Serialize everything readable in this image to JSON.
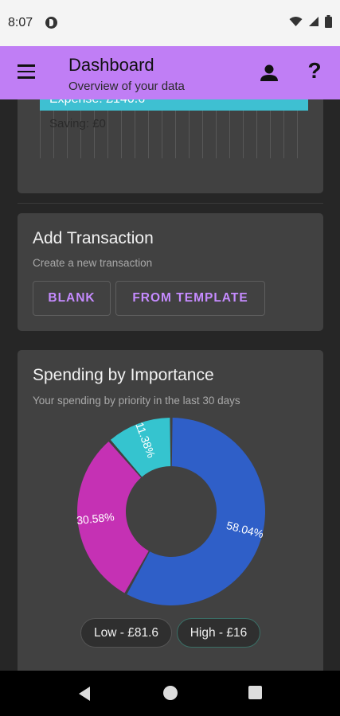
{
  "status_bar": {
    "time": "8:07",
    "icons": [
      "app-notification-icon",
      "wifi-icon",
      "signal-icon",
      "battery-icon"
    ]
  },
  "app_bar": {
    "title": "Dashboard",
    "subtitle": "Overview of your data",
    "icons": [
      "menu-icon",
      "account-icon",
      "help-icon"
    ],
    "help_glyph": "?",
    "color": "#c07ef5"
  },
  "overview_card": {
    "expense_label": "Expense: £140.6",
    "saving_label": "Saving: £0",
    "expense_color": "#3ec0d2"
  },
  "add_transaction": {
    "title": "Add Transaction",
    "subtitle": "Create a new transaction",
    "blank_label": "BLANK",
    "template_label": "FROM TEMPLATE"
  },
  "spending_importance": {
    "title": "Spending by Importance",
    "subtitle": "Your spending by priority in the last 30 days",
    "chips": {
      "low": "Low - £81.6",
      "high": "High - £16"
    }
  },
  "chart_data": {
    "type": "pie",
    "donut": true,
    "slices": [
      {
        "label": "58.04%",
        "value": 58.04,
        "color": "#2f5fc8"
      },
      {
        "label": "30.58%",
        "value": 30.58,
        "color": "#c531b4"
      },
      {
        "label": "11.38%",
        "value": 11.38,
        "color": "#35c4cf"
      }
    ]
  },
  "nav_bar": {
    "icons": [
      "back-icon",
      "home-icon",
      "recents-icon"
    ]
  }
}
